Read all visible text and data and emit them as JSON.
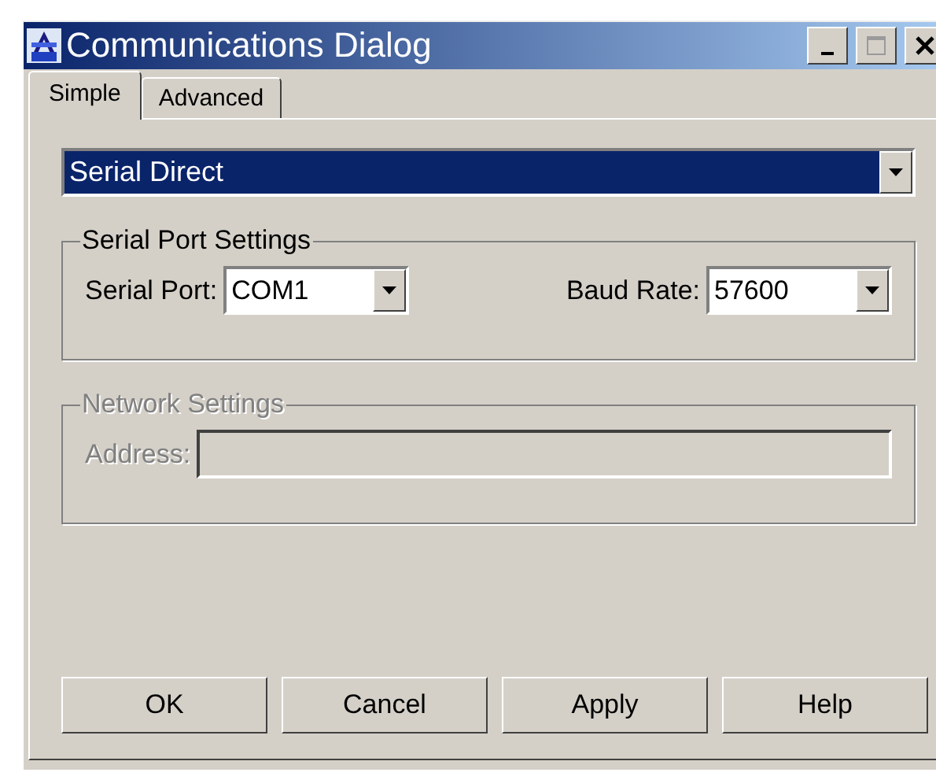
{
  "window": {
    "title": "Communications Dialog"
  },
  "tabs": [
    {
      "label": "Simple",
      "selected": true
    },
    {
      "label": "Advanced",
      "selected": false
    }
  ],
  "connection": {
    "value": "Serial Direct",
    "focused": true
  },
  "groups": [
    {
      "title": "Serial Port Settings",
      "disabled": false,
      "fields": [
        {
          "kind": "dropdown",
          "label": "Serial Port:",
          "value": "COM1"
        },
        {
          "kind": "dropdown",
          "label": "Baud Rate:",
          "value": "57600"
        }
      ]
    },
    {
      "title": "Network Settings",
      "disabled": true,
      "fields": [
        {
          "kind": "text",
          "label": "Address:"
        }
      ]
    }
  ],
  "buttons": [
    "OK",
    "Cancel",
    "Apply",
    "Help"
  ]
}
